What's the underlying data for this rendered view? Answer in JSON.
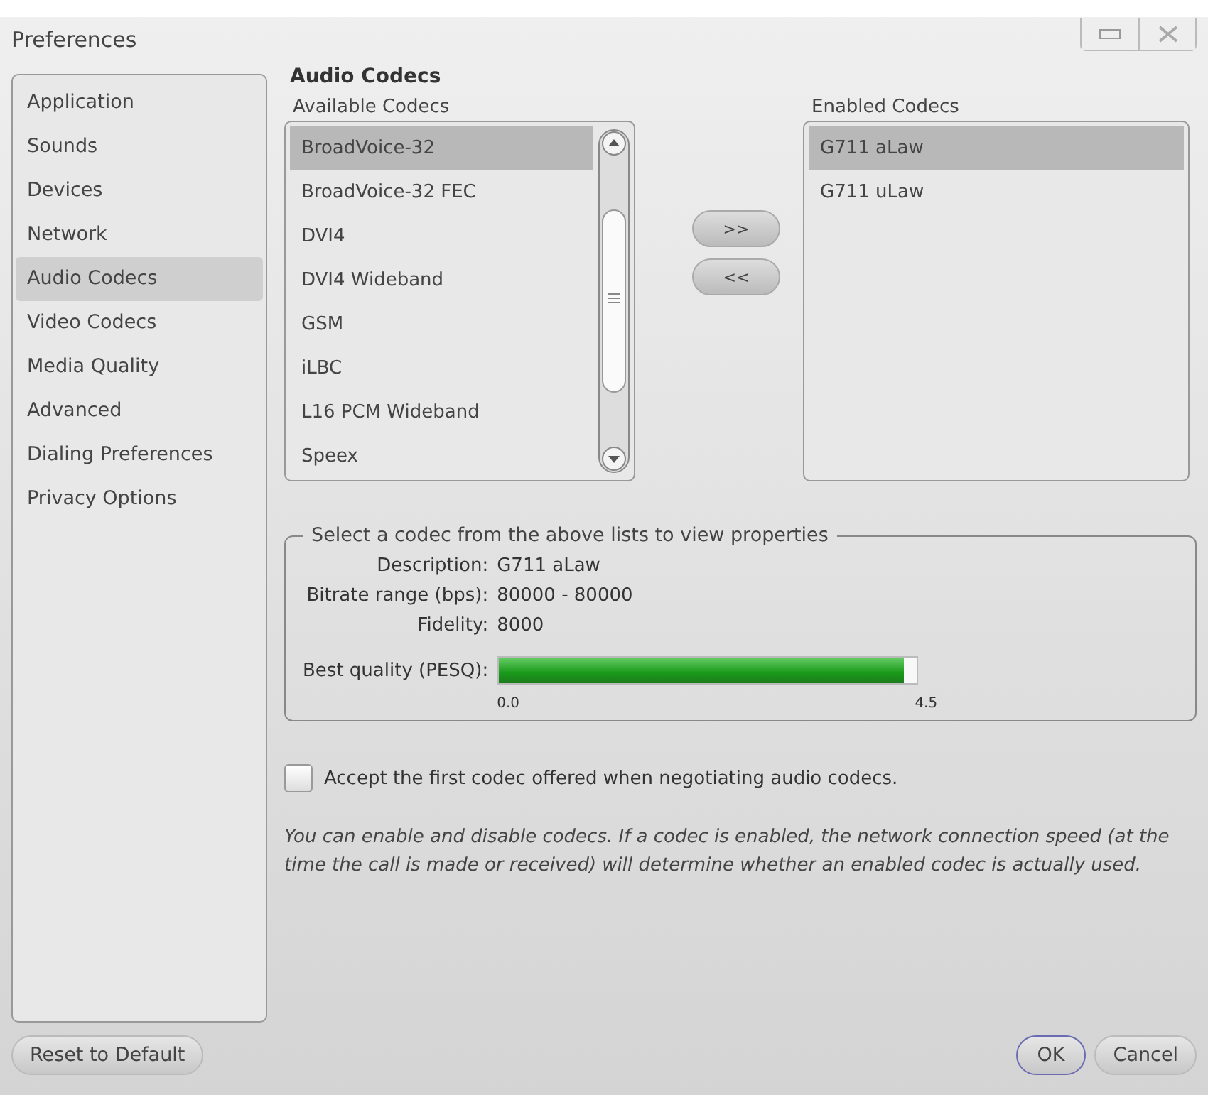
{
  "window": {
    "title": "Preferences"
  },
  "sidebar": {
    "items": [
      {
        "label": "Application",
        "selected": false
      },
      {
        "label": "Sounds",
        "selected": false
      },
      {
        "label": "Devices",
        "selected": false
      },
      {
        "label": "Network",
        "selected": false
      },
      {
        "label": "Audio Codecs",
        "selected": true
      },
      {
        "label": "Video Codecs",
        "selected": false
      },
      {
        "label": "Media Quality",
        "selected": false
      },
      {
        "label": "Advanced",
        "selected": false
      },
      {
        "label": "Dialing Preferences",
        "selected": false
      },
      {
        "label": "Privacy Options",
        "selected": false
      }
    ]
  },
  "section_title": "Audio Codecs",
  "available": {
    "label": "Available Codecs",
    "items": [
      {
        "label": "BroadVoice-32",
        "selected": true
      },
      {
        "label": "BroadVoice-32 FEC",
        "selected": false
      },
      {
        "label": "DVI4",
        "selected": false
      },
      {
        "label": "DVI4 Wideband",
        "selected": false
      },
      {
        "label": "GSM",
        "selected": false
      },
      {
        "label": "iLBC",
        "selected": false
      },
      {
        "label": "L16 PCM Wideband",
        "selected": false
      },
      {
        "label": "Speex",
        "selected": false
      }
    ]
  },
  "move_buttons": [
    ">>",
    "<<"
  ],
  "enabled": {
    "label": "Enabled Codecs",
    "items": [
      {
        "label": "G711 aLaw",
        "selected": true
      },
      {
        "label": "G711 uLaw",
        "selected": false
      }
    ]
  },
  "properties": {
    "legend": "Select a codec from the above lists to view properties",
    "fields": [
      {
        "label": "Description:",
        "value": "G711 aLaw"
      },
      {
        "label": "Bitrate range (bps):",
        "value": "80000 - 80000"
      },
      {
        "label": "Fidelity:",
        "value": "8000"
      }
    ],
    "quality": {
      "label": "Best quality (PESQ):",
      "level": 0.97,
      "min": "0.0",
      "max": "4.5"
    }
  },
  "accept_first": {
    "label": "Accept the first codec offered when negotiating audio codecs.",
    "checked": false
  },
  "note": "You can enable and disable codecs. If a codec is enabled, the network connection speed (at the time the call is made or received) will determine whether an enabled codec is actually used.",
  "buttons": {
    "reset": "Reset to Default",
    "ok": "OK",
    "cancel": "Cancel"
  }
}
